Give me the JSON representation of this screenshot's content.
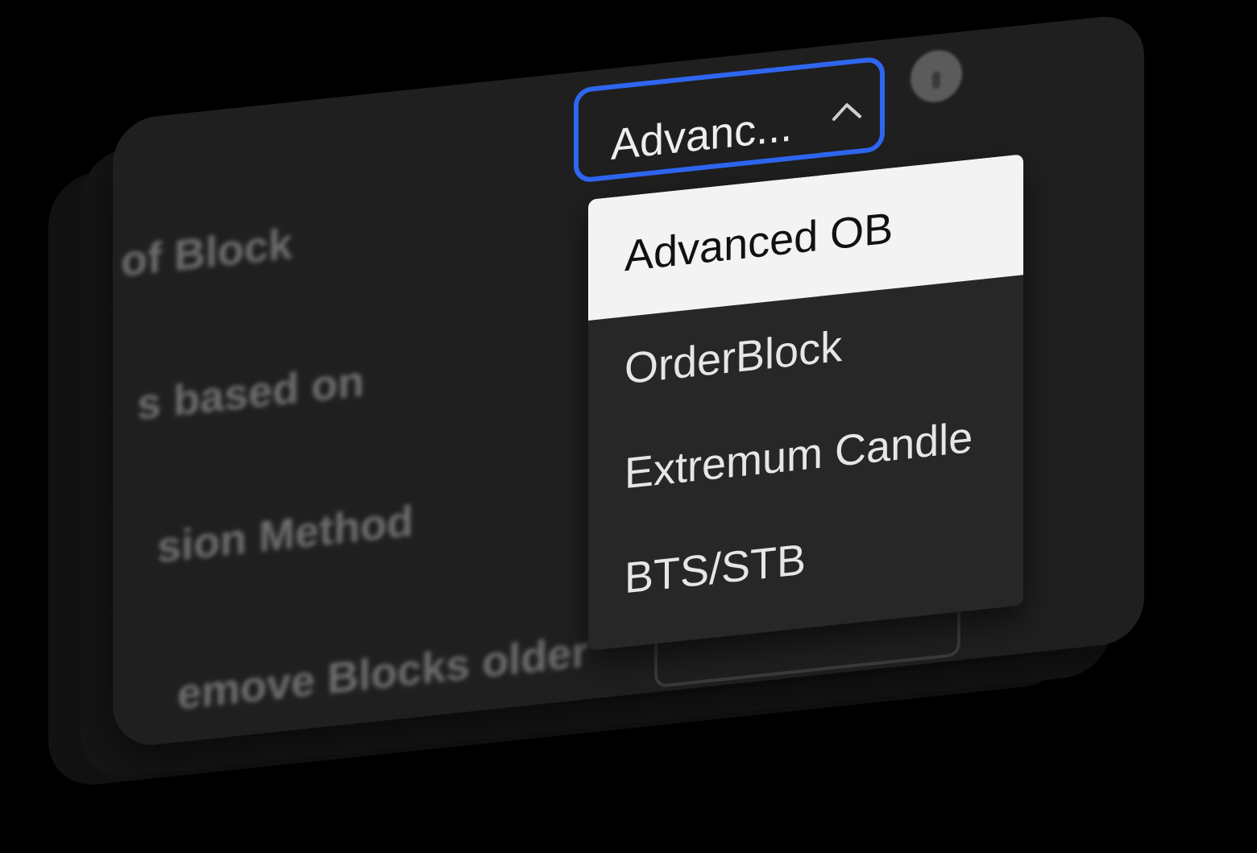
{
  "background": "#000000",
  "card": {
    "background": "#1f1f1f",
    "labels": [
      "of Block",
      "s based on",
      "sion Method",
      "emove Blocks older"
    ]
  },
  "select": {
    "value": "Advanc...",
    "border_color": "#2f66f0",
    "expanded": true,
    "chevron_icon": "chevron-up-icon"
  },
  "info_icon": "info-icon",
  "dropdown": {
    "options": [
      "Advanced OB",
      "OrderBlock",
      "Extremum Candle",
      "BTS/STB"
    ],
    "selected_index": 0
  }
}
